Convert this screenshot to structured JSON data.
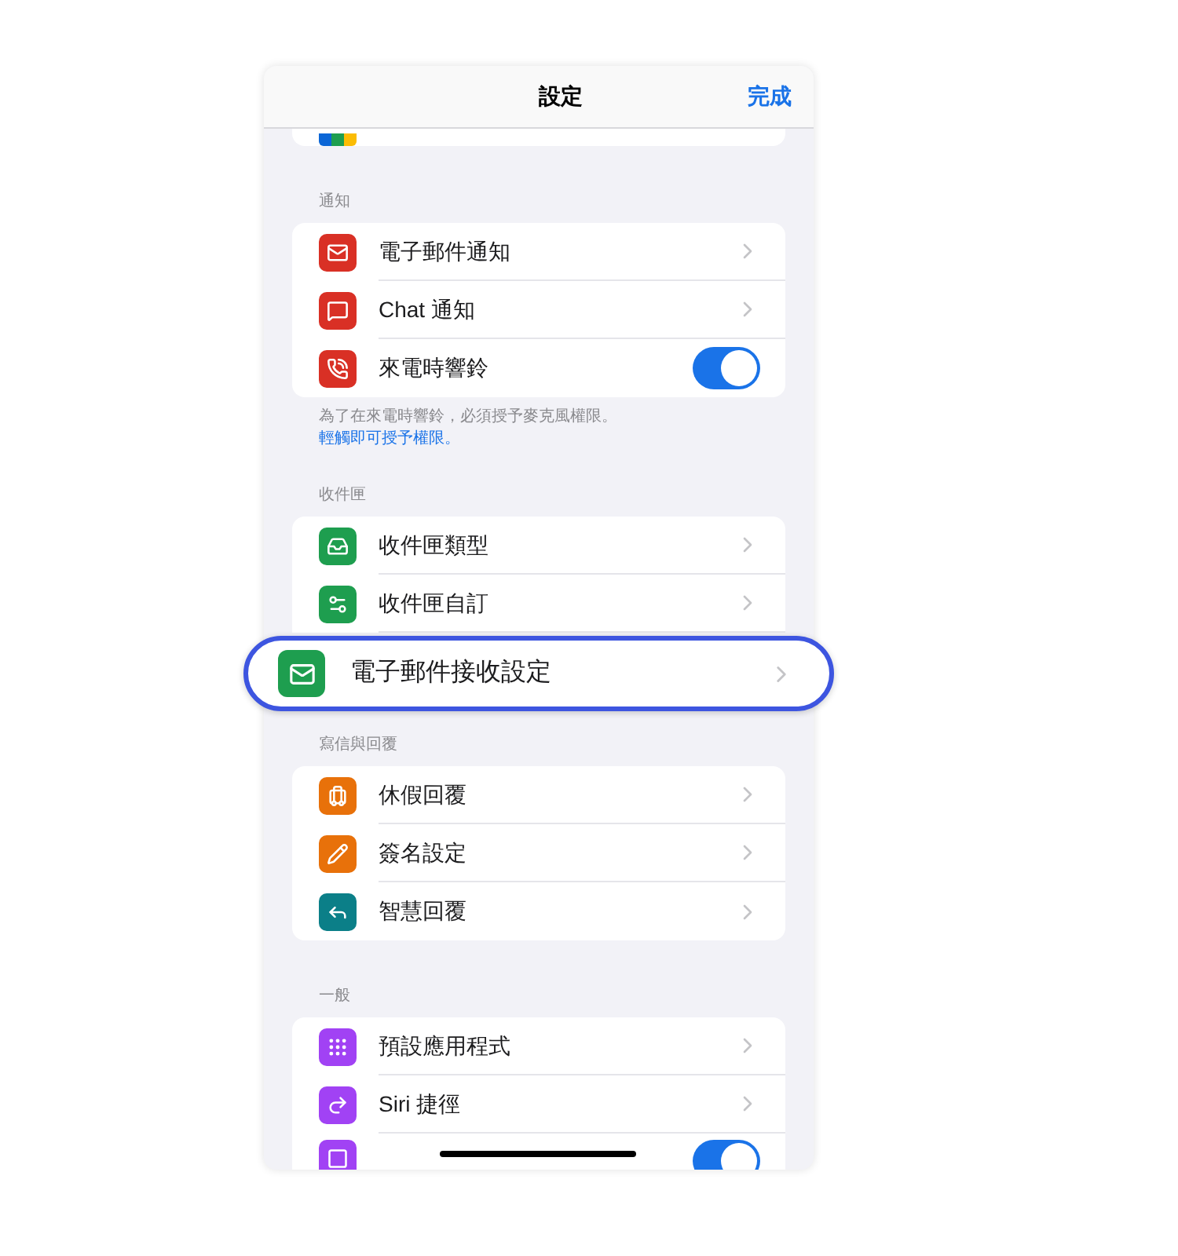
{
  "header": {
    "title": "設定",
    "done": "完成"
  },
  "sections": [
    {
      "label": "通知",
      "rows": [
        {
          "kind": "link",
          "color": "#d93025",
          "label": "電子郵件通知"
        },
        {
          "kind": "link",
          "color": "#d93025",
          "label": "Chat 通知"
        },
        {
          "kind": "toggle",
          "color": "#d93025",
          "label": "來電時響鈴",
          "on": true
        }
      ],
      "footer": "為了在來電時響鈴，必須授予麥克風權限。",
      "footer_link": "輕觸即可授予權限。"
    },
    {
      "label": "收件匣",
      "rows": [
        {
          "kind": "link",
          "color": "#1e9e4f",
          "label": "收件匣類型"
        },
        {
          "kind": "link",
          "color": "#1e9e4f",
          "label": "收件匣自訂"
        }
      ],
      "highlight": {
        "color": "#1e9e4f",
        "label": "電子郵件接收設定"
      }
    },
    {
      "label": "寫信與回覆",
      "rows": [
        {
          "kind": "link",
          "color": "#e8710a",
          "label": "休假回覆"
        },
        {
          "kind": "link",
          "color": "#e8710a",
          "label": "簽名設定"
        },
        {
          "kind": "link",
          "color": "#0b7f88",
          "label": "智慧回覆"
        }
      ]
    },
    {
      "label": "一般",
      "rows": [
        {
          "kind": "link",
          "color": "#a142f4",
          "label": "預設應用程式"
        },
        {
          "kind": "link",
          "color": "#a142f4",
          "label": "Siri 捷徑"
        }
      ],
      "cut_row": {
        "color": "#a142f4",
        "on": true
      }
    }
  ]
}
